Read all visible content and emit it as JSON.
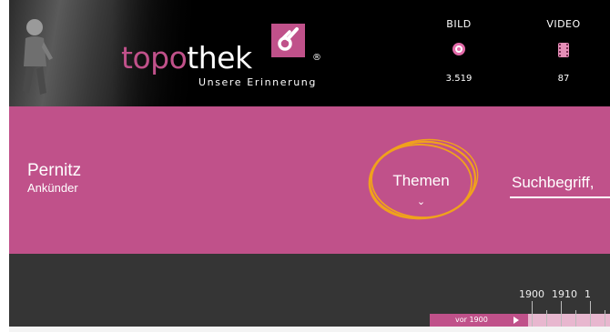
{
  "brand": {
    "word_part1": "topo",
    "word_part2": "thek",
    "registered": "®",
    "tagline": "Unsere Erinnerung",
    "color": "#c0518a"
  },
  "stats": {
    "bild": {
      "label": "BILD",
      "count": "3.519",
      "icon": "photo-target-icon"
    },
    "video": {
      "label": "VIDEO",
      "count": "87",
      "icon": "film-icon"
    }
  },
  "location": {
    "name": "Pernitz",
    "subtitle": "Ankünder"
  },
  "nav": {
    "themen_label": "Themen",
    "chevron": "⌄"
  },
  "search": {
    "placeholder": "Suchbegriff,"
  },
  "timeline": {
    "vor_label": "vor 1900",
    "years": [
      "1900",
      "1910",
      "1"
    ]
  },
  "colors": {
    "accent": "#c0518a",
    "highlight_circle": "#f0a21c",
    "timeline_bg": "#353535"
  }
}
